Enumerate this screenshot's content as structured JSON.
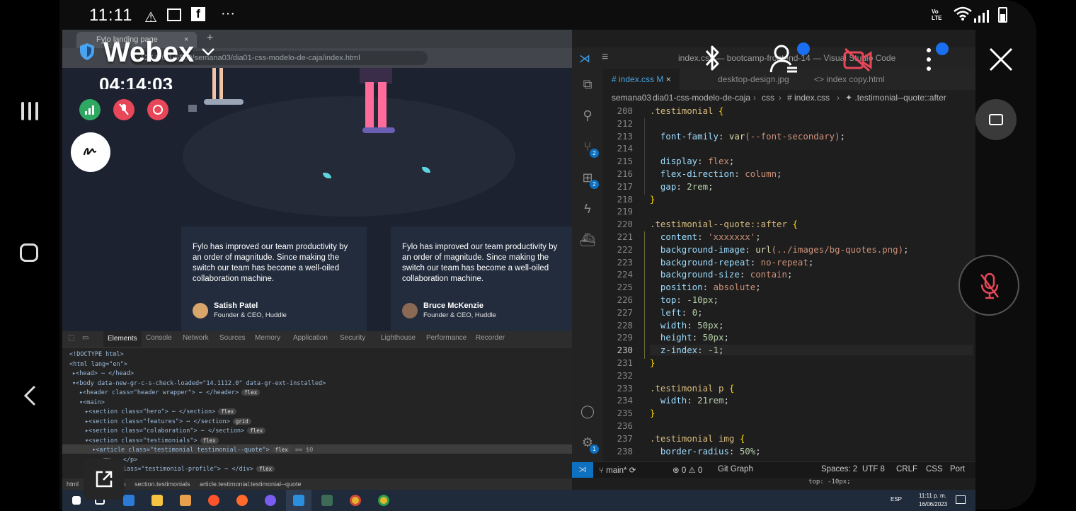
{
  "status_bar": {
    "time": "11:11",
    "more": "···",
    "network": "Vo LTE"
  },
  "webex": {
    "title": "Webex",
    "timer": "04:14:03"
  },
  "browser": {
    "tab_title": "Fylo landing page",
    "new_tab": "+",
    "url": "127.0.0.1:5500/semana03/dia01-css-modelo-de-caja/index.html",
    "cards": [
      {
        "text": "Fylo has improved our team productivity by an order of magnitude. Since making the switch our team has become a well-oiled collaboration machine.",
        "name": "Satish Patel",
        "role": "Founder & CEO, Huddle"
      },
      {
        "text": "Fylo has improved our team productivity by an order of magnitude. Since making the switch our team has become a well-oiled collaboration machine.",
        "name": "Bruce McKenzie",
        "role": "Founder & CEO, Huddle"
      }
    ]
  },
  "devtools": {
    "tabs": [
      "Elements",
      "Console",
      "Network",
      "Sources",
      "Memory",
      "Application",
      "Security",
      "Lighthouse",
      "Performance",
      "Recorder"
    ],
    "badges": {
      "flex": "flex",
      "grid": "grid"
    },
    "lines": [
      {
        "pre": "<!DOCTYPE html>"
      },
      {
        "pre": "<html lang=\"en\">"
      },
      {
        "pre": "▸<head> ⋯ </head>"
      },
      {
        "pre": "▾<body data-new-gr-c-s-check-loaded=\"14.1112.0\" data-gr-ext-installed>"
      },
      {
        "pre": "▸<header class=\"header wrapper\"> ⋯ </header>",
        "badge": "flex"
      },
      {
        "pre": "▾<main>"
      },
      {
        "pre": "▸<section class=\"hero\"> ⋯ </section>",
        "badge": "flex"
      },
      {
        "pre": "▸<section class=\"features\"> ⋯ </section>",
        "badge": "grid"
      },
      {
        "pre": "▸<section class=\"colaboration\"> ⋯ </section>",
        "badge": "flex"
      },
      {
        "pre": "▾<section class=\"testimonials\">",
        "badge": "flex"
      },
      {
        "pre": "▾<article class=\"testimonial testimonial--quote\">",
        "badge": "flex",
        "post": "== $0"
      },
      {
        "pre": "▸<p> ⋯ </p>"
      },
      {
        "pre": "▸<div class=\"testimonial-profile\"> ⋯ </div>",
        "badge": "flex"
      }
    ],
    "crumbs": [
      "html",
      "body",
      "main",
      "section.testimonials",
      "article.testimonial.testimonial--quote"
    ]
  },
  "vscode": {
    "title": "index.css — bootcamp-frontend-14 — Visual Studio Code",
    "tabs": [
      {
        "label": "# index.css M",
        "close": "×"
      },
      {
        "label": "desktop-design.jpg"
      },
      {
        "label": "<> index copy.html"
      }
    ],
    "breadcrumb": [
      "semana03",
      "dia01-css-modelo-de-caja",
      "css",
      "# index.css",
      "✦ .testimonial--quote::after"
    ],
    "activity_badges": {
      "source_control": "2",
      "extensions": "2",
      "settings": "1"
    },
    "code_lines": [
      {
        "n": "200",
        "t": ".testimonial {"
      },
      {
        "n": "212",
        "t": ""
      },
      {
        "n": "213",
        "t": "  font-family: var(--font-secondary);"
      },
      {
        "n": "214",
        "t": ""
      },
      {
        "n": "215",
        "t": "  display: flex;"
      },
      {
        "n": "216",
        "t": "  flex-direction: column;"
      },
      {
        "n": "217",
        "t": "  gap: 2rem;"
      },
      {
        "n": "218",
        "t": "}"
      },
      {
        "n": "219",
        "t": ""
      },
      {
        "n": "220",
        "t": ".testimonial--quote::after {"
      },
      {
        "n": "221",
        "t": "  content: 'xxxxxxx';"
      },
      {
        "n": "222",
        "t": "  background-image: url(../images/bg-quotes.png);"
      },
      {
        "n": "223",
        "t": "  background-repeat: no-repeat;"
      },
      {
        "n": "224",
        "t": "  background-size: contain;"
      },
      {
        "n": "225",
        "t": "  position: absolute;"
      },
      {
        "n": "226",
        "t": "  top: -10px;"
      },
      {
        "n": "227",
        "t": "  left: 0;"
      },
      {
        "n": "228",
        "t": "  width: 50px;"
      },
      {
        "n": "229",
        "t": "  height: 50px;"
      },
      {
        "n": "230",
        "t": "  z-index: -1;"
      },
      {
        "n": "231",
        "t": "}"
      },
      {
        "n": "232",
        "t": ""
      },
      {
        "n": "233",
        "t": ".testimonial p {"
      },
      {
        "n": "234",
        "t": "  width: 21rem;"
      },
      {
        "n": "235",
        "t": "}"
      },
      {
        "n": "236",
        "t": ""
      },
      {
        "n": "237",
        "t": ".testimonial img {"
      },
      {
        "n": "238",
        "t": "  border-radius: 50%;"
      }
    ],
    "current_line": "230",
    "status": {
      "branch": "main*",
      "problems": "⊗ 0 ⚠ 0",
      "git_graph": "Git Graph",
      "spaces": "Spaces: 2",
      "encoding": "UTF 8",
      "eol": "CRLF",
      "language": "CSS",
      "port": "Port",
      "hover_hint": "top: -10px;"
    }
  },
  "taskbar": {
    "lang": "ESP",
    "clock_time": "11:11 p. m.",
    "clock_date": "16/06/2023"
  },
  "colors": {
    "webex_red": "#e8475a",
    "webex_green": "#2fa862",
    "accent_blue": "#0e70c0"
  }
}
